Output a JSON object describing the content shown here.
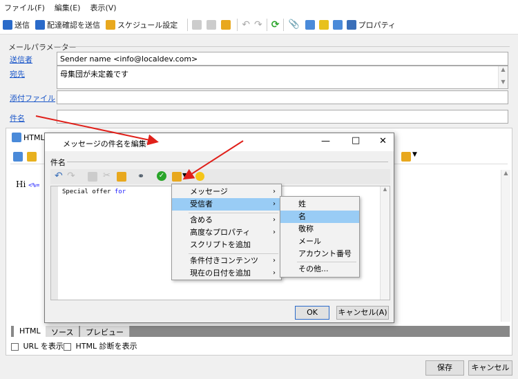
{
  "menubar": {
    "file": "ファイル(F)",
    "edit": "編集(E)",
    "view": "表示(V)"
  },
  "toolbar": {
    "send": "送信",
    "send_confirm": "配達確認を送信",
    "schedule": "スケジュール設定",
    "properties": "プロパティ"
  },
  "params": {
    "group_title": "メールパラメーター",
    "sender_label": "送信者",
    "sender_value": "Sender name <info@localdev.com>",
    "to_label": "宛先",
    "to_value": "母集団が未定義です",
    "attach_label": "添付ファイル",
    "attach_value": "",
    "subject_label": "件名",
    "subject_value": ""
  },
  "editor": {
    "tab_html": "HTML",
    "content": "Hi",
    "tag": "<%="
  },
  "bottom_tabs": [
    "HTML",
    "ソース",
    "プレビュー"
  ],
  "checks": {
    "show_url": "URL を表示",
    "html_diag": "HTML 診断を表示"
  },
  "buttons": {
    "save": "保存",
    "cancel": "キャンセル"
  },
  "dialog": {
    "title": "メッセージの件名を編集*",
    "section": "件名",
    "code_text": "Special offer ",
    "code_keyword": "for",
    "ok": "OK",
    "cancel": "キャンセル(A)",
    "controls": {
      "maximize": "□",
      "close": "✕"
    }
  },
  "context_menu": {
    "items": [
      "メッセージ",
      "受信者",
      "含める",
      "高度なプロパティ",
      "スクリプトを追加",
      "条件付きコンテンツ",
      "現在の日付を追加"
    ]
  },
  "submenu": {
    "items": [
      "姓",
      "名",
      "敬称",
      "メール",
      "アカウント番号",
      "その他..."
    ]
  },
  "colors": {
    "link": "#1a56c9",
    "highlight": "#99ccf5",
    "arrow": "#e0201a",
    "keyword": "#1a1aff"
  }
}
